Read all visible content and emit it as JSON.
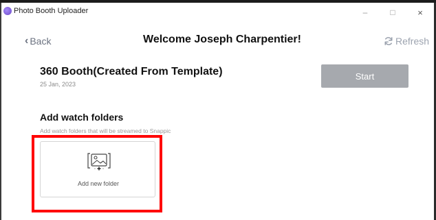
{
  "window": {
    "title": "Photo Booth Uploader",
    "controls": {
      "minimize": "–",
      "maximize": "□",
      "close": "×"
    },
    "app_icon": "photo-booth-app-icon"
  },
  "header": {
    "back_label": "Back",
    "back_icon": "chevron-left-icon",
    "welcome": "Welcome Joseph Charpentier!",
    "refresh_label": "Refresh",
    "refresh_icon": "refresh-icon"
  },
  "booth": {
    "name": "360 Booth(Created From Template)",
    "date": "25 Jan, 2023",
    "start_label": "Start"
  },
  "watch_folders": {
    "title": "Add watch folders",
    "subtitle": "Add watch folders that will be streamed to Snappic",
    "add_label": "Add new folder",
    "add_icon": "add-image-folder-icon"
  },
  "colors": {
    "start_button": "#a6a9ae",
    "highlight": "#ff0000",
    "refresh": "#9ca3af"
  }
}
